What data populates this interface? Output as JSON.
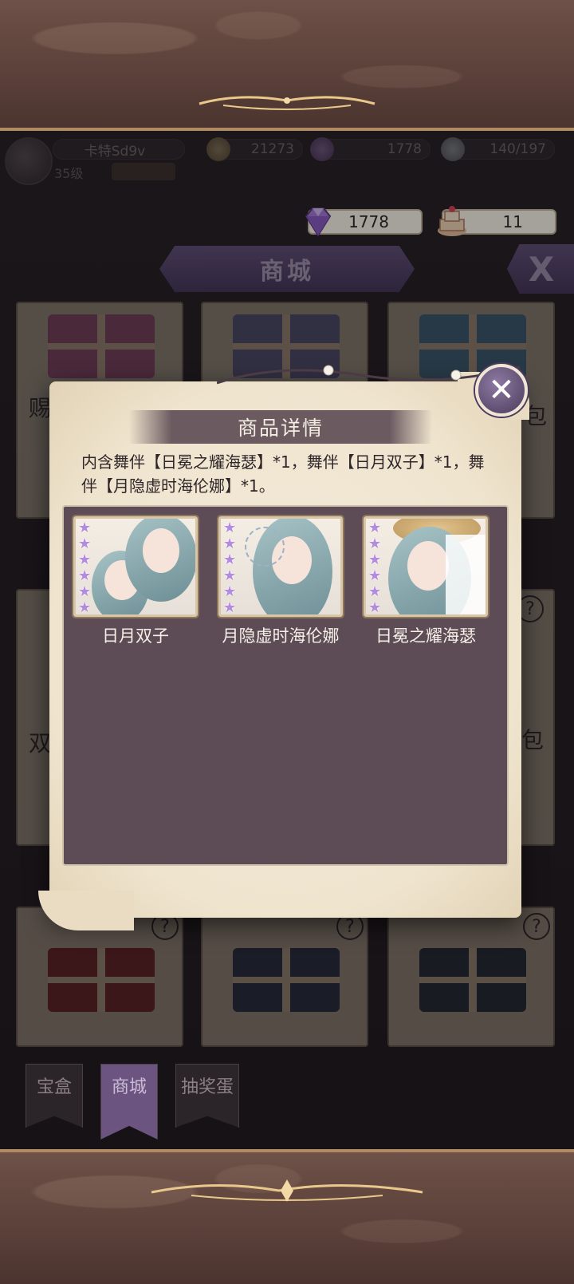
{
  "colors": {
    "accent": "#6b5480",
    "panel": "#5d4c55",
    "parchment": "#efe4ce",
    "gold": "#b08a63"
  },
  "player": {
    "name": "卡特Sd9v",
    "level": "35级",
    "coins": "21273",
    "gems": "1778",
    "stamina": "140/197"
  },
  "currency": {
    "gems": "1778",
    "cakes": "11",
    "gem_icon": "purple-gem-icon",
    "cake_icon": "cake-icon"
  },
  "shop": {
    "title": "商城",
    "close_glyph": "X"
  },
  "cards": {
    "row1_label_left": "赐福",
    "row1_label_right": "包",
    "row2_label_left": "双",
    "row2_label_right": "包",
    "help_glyph": "?"
  },
  "modal": {
    "title": "商品详情",
    "description": "内含舞伴【日冕之耀海瑟】*1，舞伴【日月双子】*1，舞伴【月隐虚时海伦娜】*1。",
    "close_glyph": "✕",
    "star_glyph": "★",
    "rewards": [
      {
        "name": "日月双子",
        "stars": 6
      },
      {
        "name": "月隐虚时海伦娜",
        "stars": 6
      },
      {
        "name": "日冕之耀海瑟",
        "stars": 6
      }
    ]
  },
  "tabs": [
    {
      "label": "宝盒"
    },
    {
      "label": "商城"
    },
    {
      "label": "抽奖蛋"
    }
  ]
}
